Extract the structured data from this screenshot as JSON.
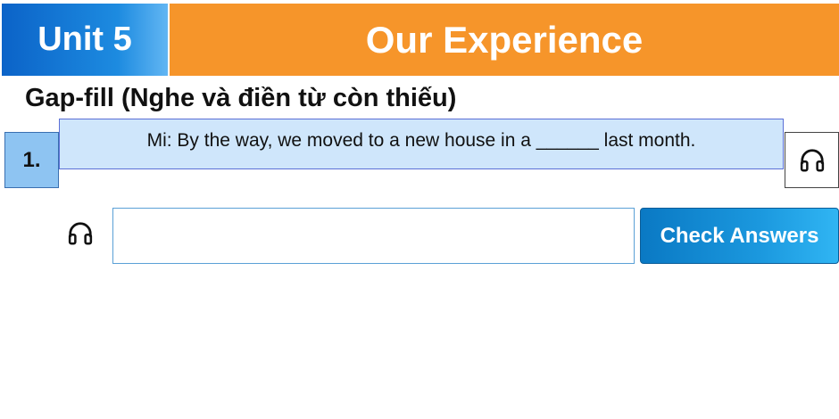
{
  "header": {
    "unit_label": "Unit 5",
    "title": "Our Experience",
    "unit_color": "#0b63c8",
    "title_color": "#f6952a"
  },
  "exercise": {
    "heading": "Gap-fill (Nghe và điền từ còn thiếu)"
  },
  "question": {
    "number": "1.",
    "sentence": "Mi: By the way, we moved to a new house in a ______ last month.",
    "audio_icon": "headphones-icon"
  },
  "answer": {
    "audio_icon": "headphones-icon",
    "value": "",
    "placeholder": "",
    "check_label": "Check Answers"
  }
}
